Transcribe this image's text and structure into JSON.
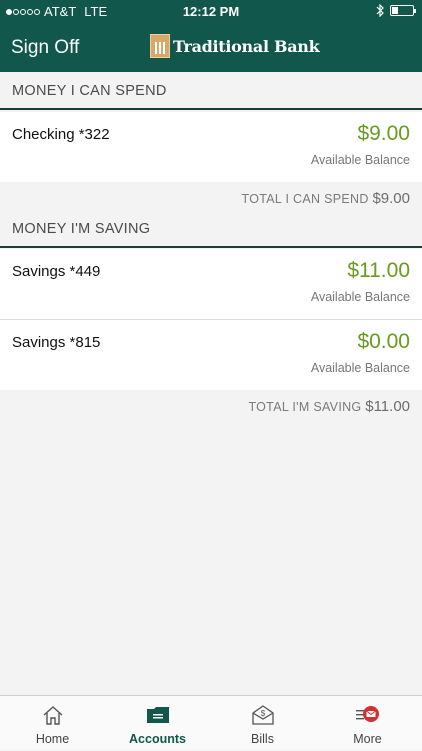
{
  "status_bar": {
    "carrier": "AT&T",
    "network": "LTE",
    "time": "12:12 PM"
  },
  "header": {
    "signoff_label": "Sign Off",
    "bank_name": "Traditional Bank"
  },
  "sections": [
    {
      "title": "MONEY I CAN SPEND",
      "accounts": [
        {
          "name": "Checking *322",
          "amount": "$9.00",
          "balance_label": "Available Balance"
        }
      ],
      "total_label": "TOTAL I CAN SPEND",
      "total_amount": "$9.00"
    },
    {
      "title": "MONEY I'M SAVING",
      "accounts": [
        {
          "name": "Savings *449",
          "amount": "$11.00",
          "balance_label": "Available Balance"
        },
        {
          "name": "Savings *815",
          "amount": "$0.00",
          "balance_label": "Available Balance"
        }
      ],
      "total_label": "TOTAL I'M SAVING",
      "total_amount": "$11.00"
    }
  ],
  "tabs": [
    {
      "label": "Home",
      "icon": "home-icon",
      "active": false
    },
    {
      "label": "Accounts",
      "icon": "accounts-icon",
      "active": true
    },
    {
      "label": "Bills",
      "icon": "bills-icon",
      "active": false
    },
    {
      "label": "More",
      "icon": "more-icon",
      "active": false
    }
  ],
  "colors": {
    "brand": "#11574b",
    "amount": "#6a9a1f",
    "badge": "#d32f2f"
  }
}
